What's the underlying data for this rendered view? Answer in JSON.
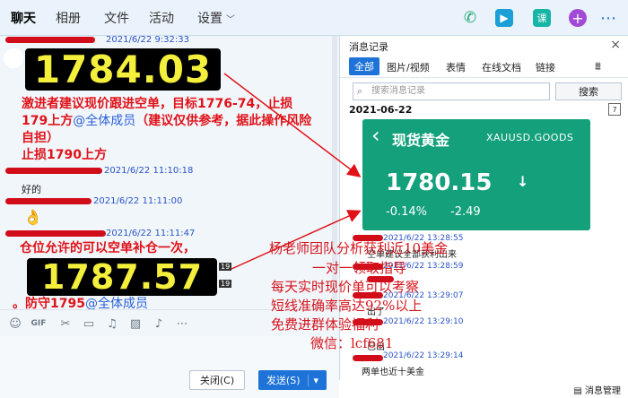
{
  "tabs": [
    {
      "label": "聊天"
    },
    {
      "label": "相册"
    },
    {
      "label": "文件"
    },
    {
      "label": "活动"
    },
    {
      "label": "设置"
    }
  ],
  "toolbar_icons": {
    "call": "phone-icon",
    "video": "video-icon",
    "class": "课",
    "plus": "+"
  },
  "chat": {
    "messages": {
      "m1_time": "2021/6/22 9:32:33",
      "m1_price": "1784.03",
      "m1_text_a": "激进者建议现价跟进空单，目标1776-74，止损179上方",
      "m1_mention": "@全体成员",
      "m1_text_b": "（建议仅供参考，据此操作风险自担）",
      "m1_text_c": "止损1790上方",
      "m2_time": "2021/6/22 11:10:18",
      "m2_text": "好的",
      "m3_time": "2021/6/22 11:11:00",
      "m4_time": "2021/6/22 11:11:47",
      "m4_text": "仓位允许的可以空单补仓一次，",
      "m4_price": "1787.57",
      "m4_timer_a": "19",
      "m4_timer_b": "19",
      "m4_stop": "。防守1795",
      "m4_mention": "@全体成员"
    }
  },
  "buttons": {
    "close": "关闭(C)",
    "send": "发送(S)",
    "send_arrow": "▾"
  },
  "panel": {
    "title": "消息记录",
    "filters": [
      "全部",
      "图片/视频",
      "表情",
      "在线文档",
      "链接"
    ],
    "search_placeholder": "搜索消息记录",
    "search_button": "搜索",
    "date": "2021-06-22",
    "cal": "7",
    "gold": {
      "name": "现货黄金",
      "symbol": "XAUUSD.GOODS",
      "price": "1780.15",
      "change_pct": "-0.14%",
      "change": "-2.49"
    },
    "entries": [
      {
        "time": "2021/6/22 13:28:55",
        "text": "空单建议全部获利出来"
      },
      {
        "time": "2021/6/22 13:28:59",
        "text": ""
      },
      {
        "time": "2021/6/22 13:29:07",
        "text": "出了"
      },
      {
        "time": "2021/6/22 13:29:10",
        "text": "已出"
      },
      {
        "time": "2021/6/22 13:29:14",
        "text": "两单也近十美金"
      }
    ],
    "manage": "消息管理"
  },
  "watermark": {
    "lines": [
      "杨老师团队分析获利近10美金",
      "一对一领取指导",
      "每天实时现价单可以考察",
      "短线准确率高达92%以上",
      "免费进群体验福利",
      "微信：lcf681"
    ]
  },
  "colors": {
    "accent": "#1e73d8",
    "gold_green": "#13a07b",
    "alert_red": "#e01218",
    "price_yellow": "#f4ef3c"
  }
}
